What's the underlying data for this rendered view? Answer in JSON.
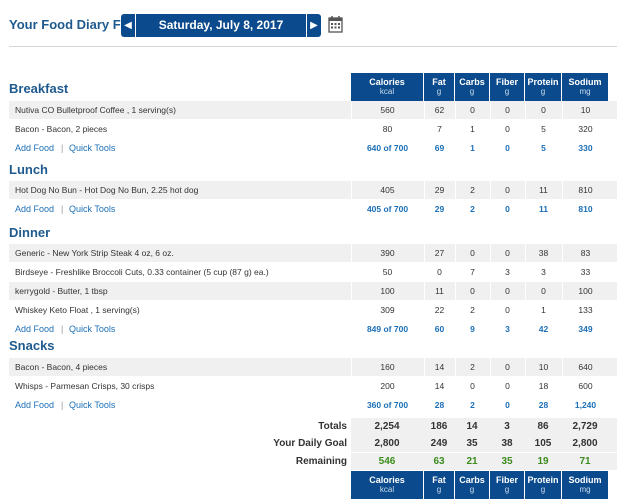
{
  "header": {
    "title": "Your Food Diary For:",
    "date": "Saturday, July 8, 2017"
  },
  "columns": [
    {
      "name": "Calories",
      "unit": "kcal"
    },
    {
      "name": "Fat",
      "unit": "g"
    },
    {
      "name": "Carbs",
      "unit": "g"
    },
    {
      "name": "Fiber",
      "unit": "g"
    },
    {
      "name": "Protein",
      "unit": "g"
    },
    {
      "name": "Sodium",
      "unit": "mg"
    }
  ],
  "links": {
    "add_food": "Add Food",
    "quick_tools": "Quick Tools",
    "separator": "|"
  },
  "meals": [
    {
      "title": "Breakfast",
      "entries": [
        {
          "name": "Nutiva CO Bulletproof Coffee , 1 serving(s)",
          "values": [
            "560",
            "62",
            "0",
            "0",
            "0",
            "10"
          ]
        },
        {
          "name": "Bacon - Bacon, 2 pieces",
          "values": [
            "80",
            "7",
            "1",
            "0",
            "5",
            "320"
          ]
        }
      ],
      "totals": [
        "640 of 700",
        "69",
        "1",
        "0",
        "5",
        "330"
      ]
    },
    {
      "title": "Lunch",
      "entries": [
        {
          "name": "Hot Dog No Bun - Hot Dog No Bun, 2.25 hot dog",
          "values": [
            "405",
            "29",
            "2",
            "0",
            "11",
            "810"
          ]
        }
      ],
      "totals": [
        "405 of 700",
        "29",
        "2",
        "0",
        "11",
        "810"
      ]
    },
    {
      "title": "Dinner",
      "entries": [
        {
          "name": "Generic - New York Strip Steak 4 oz, 6 oz.",
          "values": [
            "390",
            "27",
            "0",
            "0",
            "38",
            "83"
          ]
        },
        {
          "name": "Birdseye - Freshlike Broccoli Cuts, 0.33 container (5 cup (87 g) ea.)",
          "values": [
            "50",
            "0",
            "7",
            "3",
            "3",
            "33"
          ]
        },
        {
          "name": "kerrygold - Butter, 1 tbsp",
          "values": [
            "100",
            "11",
            "0",
            "0",
            "0",
            "100"
          ]
        },
        {
          "name": "Whiskey Keto Float , 1 serving(s)",
          "values": [
            "309",
            "22",
            "2",
            "0",
            "1",
            "133"
          ]
        }
      ],
      "totals": [
        "849 of 700",
        "60",
        "9",
        "3",
        "42",
        "349"
      ]
    },
    {
      "title": "Snacks",
      "entries": [
        {
          "name": "Bacon - Bacon, 4 pieces",
          "values": [
            "160",
            "14",
            "2",
            "0",
            "10",
            "640"
          ]
        },
        {
          "name": "Whisps - Parmesan Crisps, 30 crisps",
          "values": [
            "200",
            "14",
            "0",
            "0",
            "18",
            "600"
          ]
        }
      ],
      "totals": [
        "360 of 700",
        "28",
        "2",
        "0",
        "28",
        "1,240"
      ]
    }
  ],
  "summary": [
    {
      "label": "Totals",
      "values": [
        "2,254",
        "186",
        "14",
        "3",
        "86",
        "2,729"
      ],
      "color": "#333333"
    },
    {
      "label": "Your Daily Goal",
      "values": [
        "2,800",
        "249",
        "35",
        "38",
        "105",
        "2,800"
      ],
      "color": "#333333"
    },
    {
      "label": "Remaining",
      "values": [
        "546",
        "63",
        "21",
        "35",
        "19",
        "71"
      ],
      "color": "#3a8c1c"
    }
  ],
  "colors": {
    "header_blue": "#0b4a8c",
    "link_blue": "#1b6fb7",
    "title_blue": "#1f5a8e",
    "remaining_green": "#3a8c1c"
  }
}
